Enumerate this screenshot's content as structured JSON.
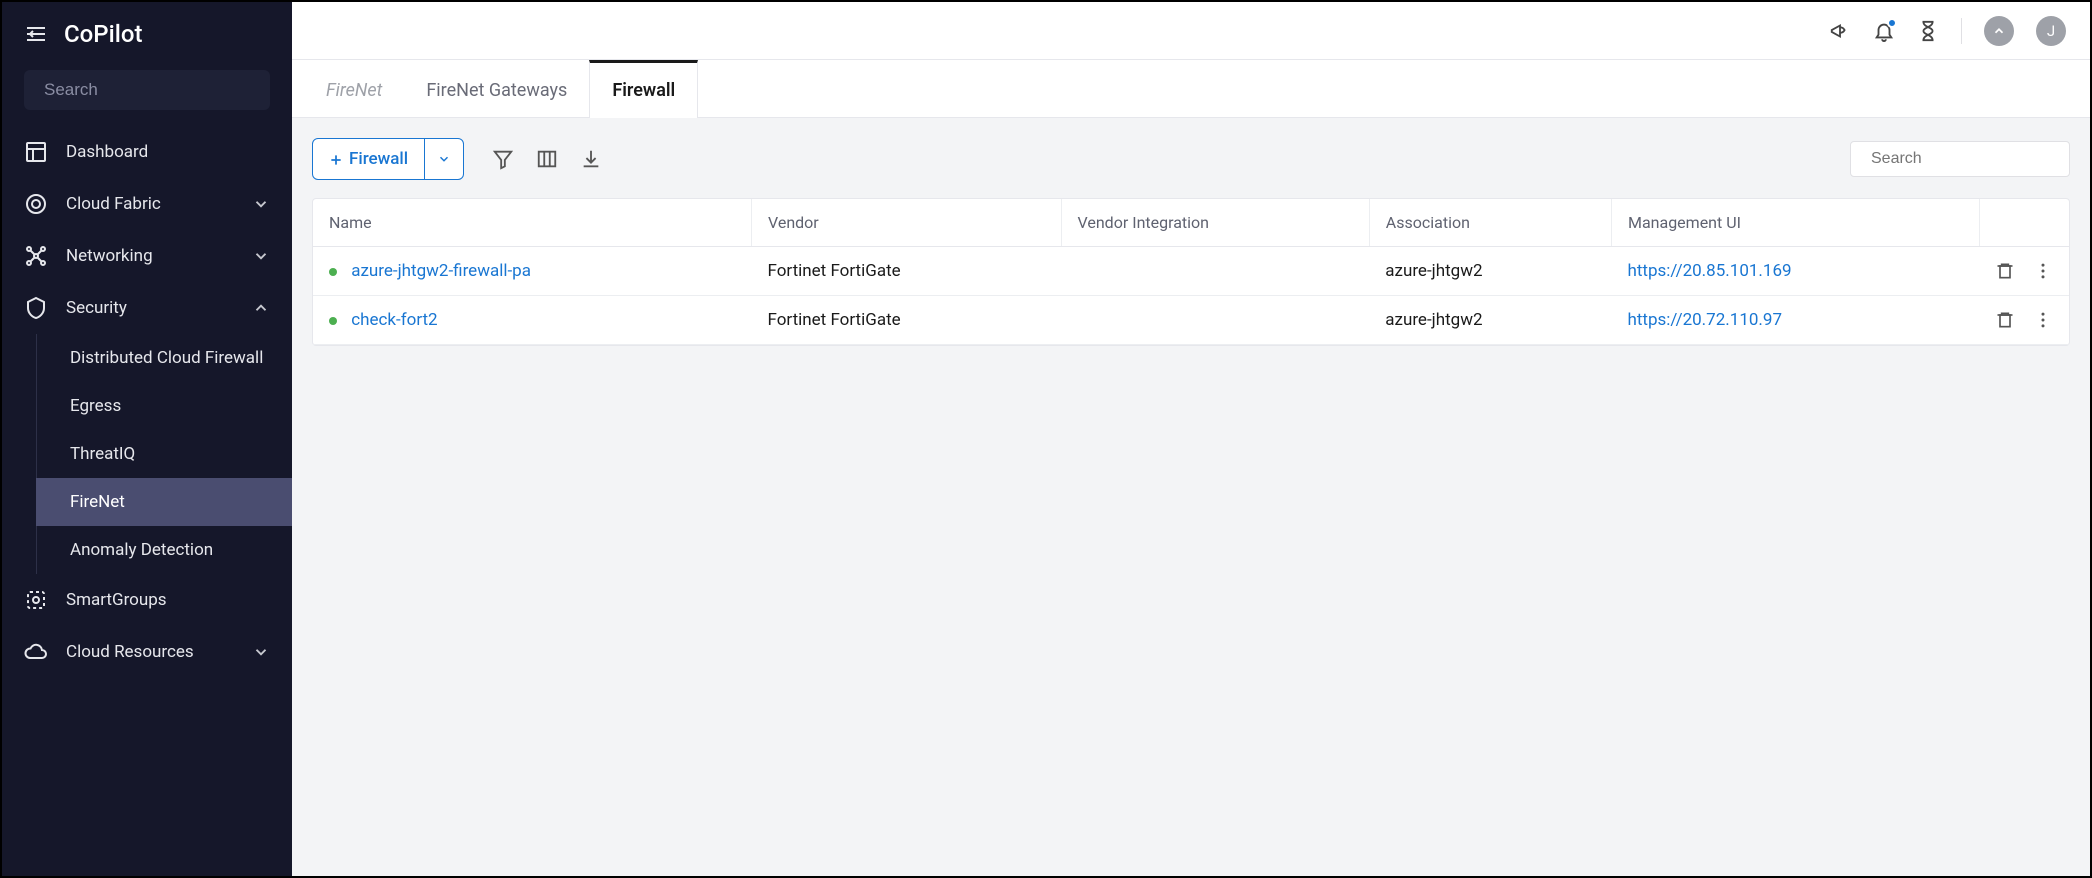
{
  "app": {
    "title": "CoPilot"
  },
  "sidebar": {
    "search_placeholder": "Search",
    "items": [
      {
        "label": "Dashboard"
      },
      {
        "label": "Cloud Fabric"
      },
      {
        "label": "Networking"
      },
      {
        "label": "Security"
      },
      {
        "label": "SmartGroups"
      },
      {
        "label": "Cloud Resources"
      }
    ],
    "security_sub": [
      {
        "label": "Distributed Cloud Firewall"
      },
      {
        "label": "Egress"
      },
      {
        "label": "ThreatIQ"
      },
      {
        "label": "FireNet"
      },
      {
        "label": "Anomaly Detection"
      }
    ]
  },
  "tabs": [
    {
      "label": "FireNet"
    },
    {
      "label": "FireNet Gateways"
    },
    {
      "label": "Firewall"
    }
  ],
  "toolbar": {
    "add_label": "Firewall",
    "search_placeholder": "Search"
  },
  "table": {
    "columns": [
      "Name",
      "Vendor",
      "Vendor Integration",
      "Association",
      "Management UI"
    ],
    "rows": [
      {
        "name": "azure-jhtgw2-firewall-pa",
        "vendor": "Fortinet FortiGate",
        "vendor_integration": "",
        "association": "azure-jhtgw2",
        "management_ui": "https://20.85.101.169"
      },
      {
        "name": "check-fort2",
        "vendor": "Fortinet FortiGate",
        "vendor_integration": "",
        "association": "azure-jhtgw2",
        "management_ui": "https://20.72.110.97"
      }
    ]
  },
  "avatar": {
    "initial": "J"
  }
}
